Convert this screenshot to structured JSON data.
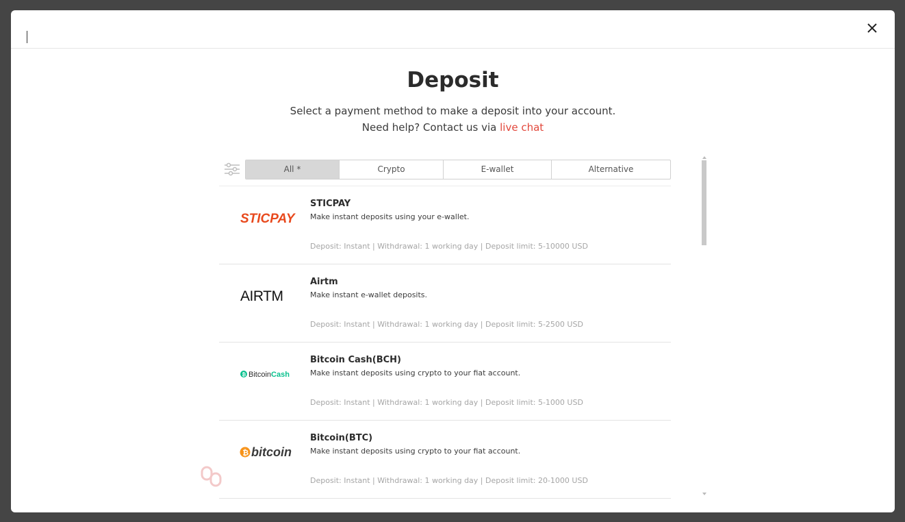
{
  "header": {
    "close_icon": "close-icon"
  },
  "title": "Deposit",
  "subtitle": "Select a payment method to make a deposit into your account.",
  "help": {
    "prefix": "Need help? Contact us via ",
    "link": "live chat",
    "link_color": "#e2473b"
  },
  "filter_icon": "sliders-icon",
  "tabs": [
    {
      "label": "All *",
      "active": true
    },
    {
      "label": "Crypto",
      "active": false
    },
    {
      "label": "E-wallet",
      "active": false
    },
    {
      "label": "Alternative",
      "active": false
    }
  ],
  "methods": [
    {
      "logo_text": "STICPAY",
      "name": "STICPAY",
      "description": "Make instant deposits using your e-wallet.",
      "meta": "Deposit: Instant | Withdrawal: 1 working day | Deposit limit: 5-10000 USD"
    },
    {
      "logo_text": "AIRTM",
      "name": "Airtm",
      "description": "Make instant e-wallet deposits.",
      "meta": "Deposit: Instant | Withdrawal: 1 working day | Deposit limit: 5-2500 USD"
    },
    {
      "logo_text": "BitcoinCash",
      "name": "Bitcoin Cash(BCH)",
      "description": "Make instant deposits using crypto to your fiat account.",
      "meta": "Deposit: Instant | Withdrawal: 1 working day | Deposit limit: 5-1000 USD"
    },
    {
      "logo_text": "bitcoin",
      "name": "Bitcoin(BTC)",
      "description": "Make instant deposits using crypto to your fiat account.",
      "meta": "Deposit: Instant | Withdrawal: 1 working day | Deposit limit: 20-1000 USD"
    }
  ],
  "colors": {
    "overlay": "#454545",
    "sticpay": "#e8491d",
    "bitcoin_cash": "#0ac18e",
    "bitcoin": "#f7931a"
  }
}
